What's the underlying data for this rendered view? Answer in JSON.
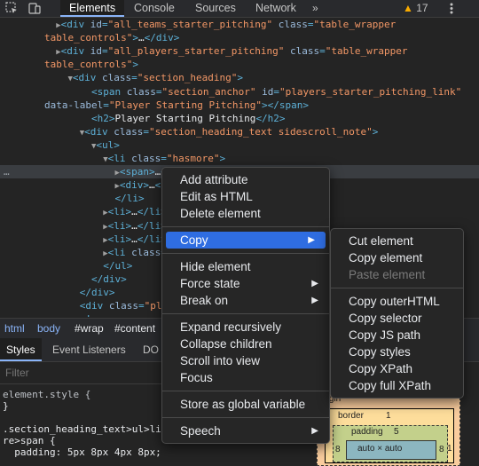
{
  "toolbar": {
    "icons": [
      "inspect-icon",
      "device-toolbar-icon"
    ],
    "tabs": [
      "Elements",
      "Console",
      "Sources",
      "Network"
    ],
    "more": "»",
    "warnings_count": "17",
    "menu_icon": "kebab-menu-icon"
  },
  "tree": {
    "lines": [
      {
        "indent": "  ",
        "arrow": "▶",
        "parts": [
          [
            "tag",
            "<div "
          ],
          [
            "attr",
            "id"
          ],
          [
            "tag",
            "="
          ],
          [
            "val",
            "\"all_teams_starter_pitching\""
          ],
          [
            "attr",
            " class"
          ],
          [
            "tag",
            "="
          ],
          [
            "val",
            "\"table_wrapper"
          ]
        ]
      },
      {
        "indent": "",
        "arrow": "",
        "parts": [
          [
            "val",
            "table_controls\""
          ],
          [
            "tag",
            ">"
          ],
          [
            "txt",
            "…"
          ],
          [
            "tag",
            "</div>"
          ]
        ]
      },
      {
        "indent": "  ",
        "arrow": "▶",
        "parts": [
          [
            "tag",
            "<div "
          ],
          [
            "attr",
            "id"
          ],
          [
            "tag",
            "="
          ],
          [
            "val",
            "\"all_players_starter_pitching\""
          ],
          [
            "attr",
            " class"
          ],
          [
            "tag",
            "="
          ],
          [
            "val",
            "\"table_wrapper"
          ]
        ]
      },
      {
        "indent": "",
        "arrow": "",
        "parts": [
          [
            "val",
            "table_controls\""
          ],
          [
            "tag",
            ">"
          ]
        ]
      },
      {
        "indent": "    ",
        "arrow": "▼",
        "parts": [
          [
            "tag",
            "<div "
          ],
          [
            "attr",
            "class"
          ],
          [
            "tag",
            "="
          ],
          [
            "val",
            "\"section_heading\""
          ],
          [
            "tag",
            ">"
          ]
        ]
      },
      {
        "indent": "        ",
        "arrow": "",
        "parts": [
          [
            "tag",
            "<span "
          ],
          [
            "attr",
            "class"
          ],
          [
            "tag",
            "="
          ],
          [
            "val",
            "\"section_anchor\""
          ],
          [
            "attr",
            " id"
          ],
          [
            "tag",
            "="
          ],
          [
            "val",
            "\"players_starter_pitching_link\""
          ]
        ]
      },
      {
        "indent": "",
        "arrow": "",
        "parts": [
          [
            "attr",
            "data-label"
          ],
          [
            "tag",
            "="
          ],
          [
            "val",
            "\"Player Starting Pitching\""
          ],
          [
            "tag",
            "></span>"
          ]
        ]
      },
      {
        "indent": "        ",
        "arrow": "",
        "parts": [
          [
            "tag",
            "<h2>"
          ],
          [
            "txt",
            "Player Starting Pitching"
          ],
          [
            "tag",
            "</h2>"
          ]
        ]
      },
      {
        "indent": "      ",
        "arrow": "▼",
        "parts": [
          [
            "tag",
            "<div "
          ],
          [
            "attr",
            "class"
          ],
          [
            "tag",
            "="
          ],
          [
            "val",
            "\"section_heading_text sidescroll_note\""
          ],
          [
            "tag",
            ">"
          ]
        ]
      },
      {
        "indent": "        ",
        "arrow": "▼",
        "parts": [
          [
            "tag",
            "<ul>"
          ]
        ]
      },
      {
        "indent": "          ",
        "arrow": "▼",
        "parts": [
          [
            "tag",
            "<li "
          ],
          [
            "attr",
            "class"
          ],
          [
            "tag",
            "="
          ],
          [
            "val",
            "\"hasmore\""
          ],
          [
            "tag",
            ">"
          ]
        ]
      },
      {
        "indent": "            ",
        "arrow": "▶",
        "parts": [
          [
            "tag",
            "<span>"
          ],
          [
            "txt",
            "…"
          ],
          [
            "tag",
            "</span>"
          ]
        ]
      },
      {
        "indent": "            ",
        "arrow": "▶",
        "parts": [
          [
            "tag",
            "<div>"
          ],
          [
            "txt",
            "…"
          ],
          [
            "tag",
            "</div>"
          ]
        ]
      },
      {
        "indent": "            ",
        "arrow": "",
        "parts": [
          [
            "tag",
            "</li>"
          ]
        ]
      },
      {
        "indent": "          ",
        "arrow": "▶",
        "parts": [
          [
            "tag",
            "<li>"
          ],
          [
            "txt",
            "…"
          ],
          [
            "tag",
            "</li>"
          ]
        ]
      },
      {
        "indent": "          ",
        "arrow": "▶",
        "parts": [
          [
            "tag",
            "<li>"
          ],
          [
            "txt",
            "…"
          ],
          [
            "tag",
            "</li>"
          ]
        ]
      },
      {
        "indent": "          ",
        "arrow": "▶",
        "parts": [
          [
            "tag",
            "<li>"
          ],
          [
            "txt",
            "…"
          ],
          [
            "tag",
            "</li>"
          ]
        ]
      },
      {
        "indent": "          ",
        "arrow": "▶",
        "parts": [
          [
            "tag",
            "<li "
          ],
          [
            "attr",
            "class"
          ],
          [
            "tag",
            "="
          ],
          [
            "val",
            "\"hasmore\""
          ],
          [
            "tag",
            ">"
          ]
        ]
      },
      {
        "indent": "          ",
        "arrow": "",
        "parts": [
          [
            "tag",
            "</ul>"
          ]
        ]
      },
      {
        "indent": "        ",
        "arrow": "",
        "parts": [
          [
            "tag",
            "</div>"
          ]
        ]
      },
      {
        "indent": "      ",
        "arrow": "",
        "parts": [
          [
            "tag",
            "</div>"
          ]
        ]
      },
      {
        "indent": "      ",
        "arrow": "",
        "parts": [
          [
            "tag",
            "<div "
          ],
          [
            "attr",
            "class"
          ],
          [
            "tag",
            "="
          ],
          [
            "val",
            "\"placeholder\""
          ],
          [
            "tag",
            "></div>"
          ]
        ]
      },
      {
        "indent": "      ",
        "arrow": "",
        "parts": [
          [
            "tag",
            "<!--"
          ]
        ]
      }
    ],
    "selected_index": 11,
    "ellipsis": "…"
  },
  "breadcrumbs": [
    "html",
    "body",
    "#wrap",
    "#content"
  ],
  "lower_tabs": [
    "Styles",
    "Event Listeners",
    "DO"
  ],
  "filter": {
    "placeholder": "Filter"
  },
  "styles": {
    "lines": [
      "element.style {",
      "}",
      "",
      ".section_heading_text>ul>li",
      "re>span {",
      "  padding: 5px 8px 4px 8px;"
    ]
  },
  "box_model": {
    "margin_label": "argin",
    "border_label": "border",
    "border_value": "1",
    "padding_label": "padding",
    "padding_value": "5",
    "content_label": "auto × auto",
    "side_left": "8",
    "side_right": "8",
    "side_right2": "1"
  },
  "context_menu": {
    "items": [
      {
        "label": "Add attribute"
      },
      {
        "label": "Edit as HTML"
      },
      {
        "label": "Delete element"
      },
      {
        "sep": true
      },
      {
        "label": "Copy",
        "submenu": true,
        "highlighted": true
      },
      {
        "sep": true
      },
      {
        "label": "Hide element"
      },
      {
        "label": "Force state",
        "submenu": true
      },
      {
        "label": "Break on",
        "submenu": true
      },
      {
        "sep": true
      },
      {
        "label": "Expand recursively"
      },
      {
        "label": "Collapse children"
      },
      {
        "label": "Scroll into view"
      },
      {
        "label": "Focus"
      },
      {
        "sep": true
      },
      {
        "label": "Store as global variable"
      },
      {
        "sep": true
      },
      {
        "label": "Speech",
        "submenu": true
      }
    ],
    "submenu_arrow": "▶"
  },
  "copy_submenu": {
    "items": [
      {
        "label": "Cut element"
      },
      {
        "label": "Copy element"
      },
      {
        "label": "Paste element",
        "disabled": true
      },
      {
        "sep": true
      },
      {
        "label": "Copy outerHTML"
      },
      {
        "label": "Copy selector"
      },
      {
        "label": "Copy JS path"
      },
      {
        "label": "Copy styles"
      },
      {
        "label": "Copy XPath"
      },
      {
        "label": "Copy full XPath"
      }
    ]
  }
}
